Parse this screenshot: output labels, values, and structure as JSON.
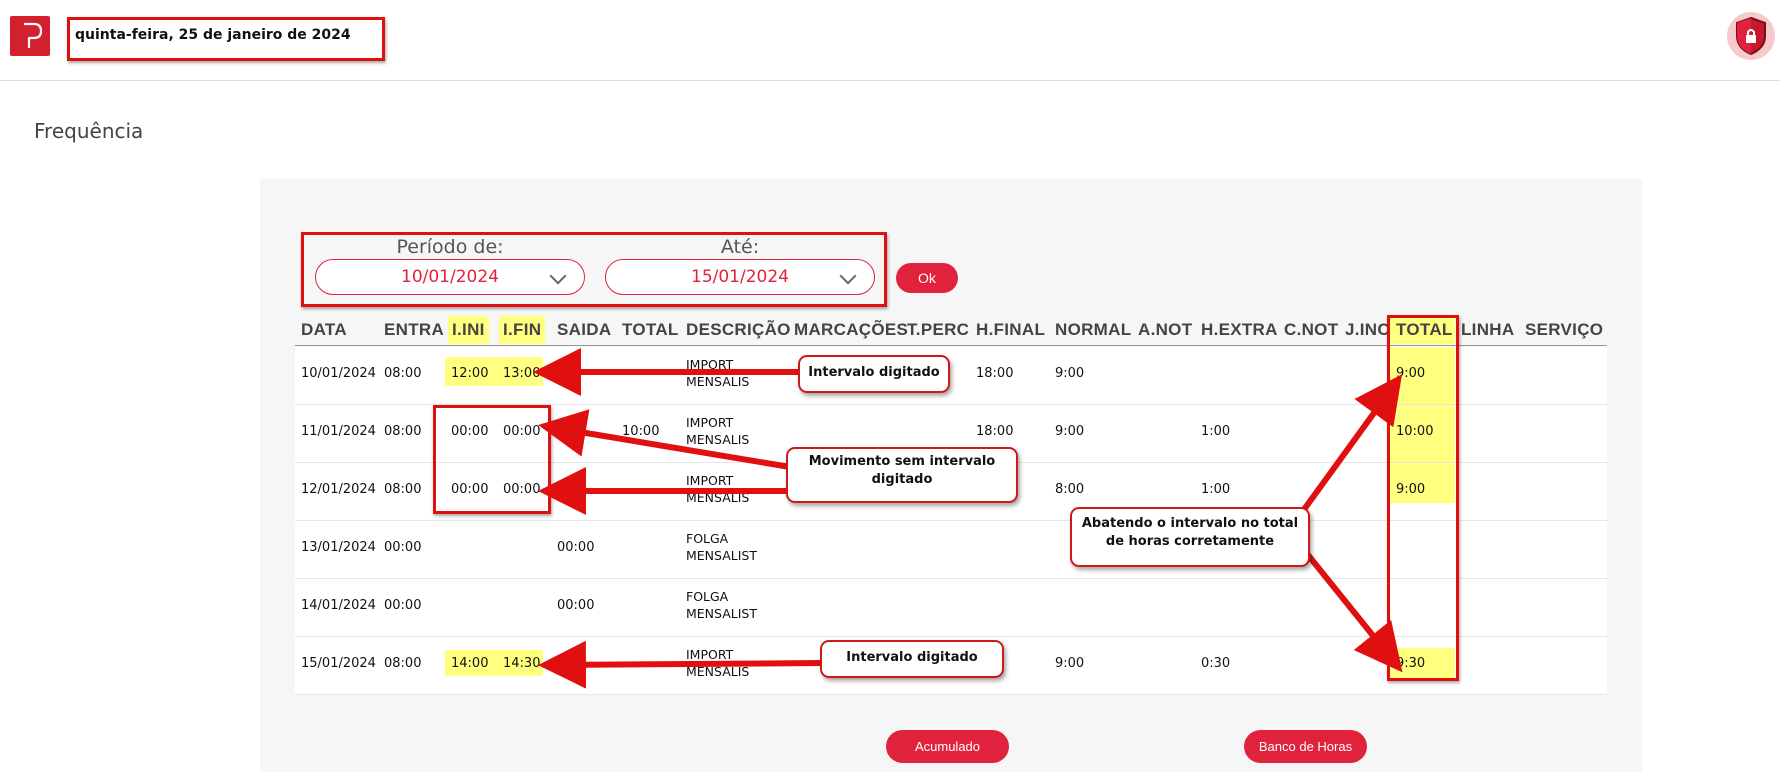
{
  "header": {
    "date": "quinta-feira, 25 de janeiro de 2024"
  },
  "page": {
    "title": "Frequência"
  },
  "filter": {
    "from_label": "Período de:",
    "from_value": "10/01/2024",
    "to_label": "Até:",
    "to_value": "15/01/2024",
    "ok_label": "Ok"
  },
  "table": {
    "columns": [
      "DATA",
      "ENTRA",
      "I.INI",
      "I.FIN",
      "SAIDA",
      "TOTAL",
      "DESCRIÇÃO",
      "MARCAÇÕES",
      "T.PERC",
      "H.FINAL",
      "NORMAL",
      "A.NOT",
      "H.EXTRA",
      "C.NOT",
      "J.INC",
      "TOTAL",
      "LINHA",
      "SERVIÇO"
    ],
    "rows": [
      {
        "data": "10/01/2024",
        "entra": "08:00",
        "iini": "12:00",
        "ifin": "13:00",
        "saida": "",
        "total": "",
        "desc1": "IMPORT",
        "desc2": "MENSALIS",
        "hfinal": "18:00",
        "normal": "9:00",
        "hextra": "",
        "total2": "9:00"
      },
      {
        "data": "11/01/2024",
        "entra": "08:00",
        "iini": "00:00",
        "ifin": "00:00",
        "saida": "",
        "total": "10:00",
        "desc1": "IMPORT",
        "desc2": "MENSALIS",
        "hfinal": "18:00",
        "normal": "9:00",
        "hextra": "1:00",
        "total2": "10:00"
      },
      {
        "data": "12/01/2024",
        "entra": "08:00",
        "iini": "00:00",
        "ifin": "00:00",
        "saida": "",
        "total": "",
        "desc1": "IMPORT",
        "desc2": "MENSALIS",
        "hfinal": "",
        "normal": "8:00",
        "hextra": "1:00",
        "total2": "9:00"
      },
      {
        "data": "13/01/2024",
        "entra": "00:00",
        "iini": "",
        "ifin": "",
        "saida": "00:00",
        "total": "",
        "desc1": "FOLGA",
        "desc2": "MENSALIST",
        "hfinal": "",
        "normal": "",
        "hextra": "",
        "total2": ""
      },
      {
        "data": "14/01/2024",
        "entra": "00:00",
        "iini": "",
        "ifin": "",
        "saida": "00:00",
        "total": "",
        "desc1": "FOLGA",
        "desc2": "MENSALIST",
        "hfinal": "",
        "normal": "",
        "hextra": "",
        "total2": ""
      },
      {
        "data": "15/01/2024",
        "entra": "08:00",
        "iini": "14:00",
        "ifin": "14:30",
        "saida": "",
        "total": "",
        "desc1": "IMPORT",
        "desc2": "MENSALIS",
        "hfinal": "",
        "normal": "9:00",
        "hextra": "0:30",
        "total2": "9:30"
      }
    ]
  },
  "annotations": {
    "callout1": "Intervalo digitado",
    "callout2_line1": "Movimento sem intervalo",
    "callout2_line2": "digitado",
    "callout3_line1": "Abatendo o intervalo no total",
    "callout3_line2": "de horas corretamente",
    "callout4": "Intervalo digitado"
  },
  "buttons": {
    "accumulated": "Acumulado",
    "hours_bank": "Banco de Horas"
  },
  "colors": {
    "accent": "#e0223c",
    "highlight": "#ffff80",
    "annotation": "#e01010"
  },
  "icons": {
    "logo": "p-logo",
    "security": "shield-lock-icon"
  }
}
